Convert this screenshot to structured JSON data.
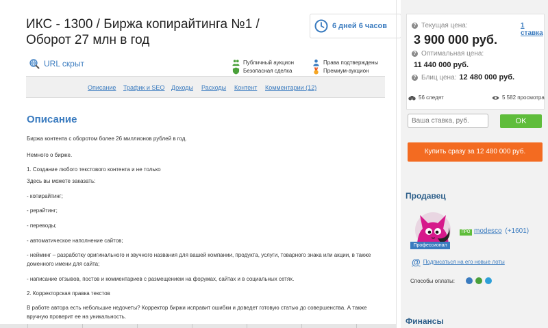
{
  "lot": {
    "title": "ИКС - 1300 / Биржа копирайтинга №1 / Оборот 27 млн в год",
    "timer": "6 дней 6 часов",
    "url_text": "URL скрыт"
  },
  "features": {
    "public_auction": "Публичный аукцион",
    "safe_deal": "Безопасная сделка",
    "rights_confirmed": "Права подтверждены",
    "premium_auction": "Премиум-аукцион"
  },
  "tabs": [
    {
      "label": "Описание"
    },
    {
      "label": "Трафик и SEO"
    },
    {
      "label": "Доходы"
    },
    {
      "label": "Расходы"
    },
    {
      "label": "Контент"
    },
    {
      "label": "Комментарии (12)"
    }
  ],
  "description": {
    "heading": "Описание",
    "paragraphs": [
      "Биржа контента с оборотом более 26 миллионов рублей в год.",
      "Немного о бирже.",
      "1. Создание любого текстового контента и не только",
      "Здесь вы можете заказать:",
      "- копирайтинг;",
      "- рерайтинг;",
      "- переводы;",
      "- автоматическое наполнение сайтов;",
      "- нейминг – разработку оригинального и звучного названия для вашей компании, продукта, услуги, товарного знака или акции, в также доменного имени для сайта;",
      "- написание отзывов, постов и комментариев с размещением на форумах, сайтах и в социальных сетях.",
      "2. Корректорская правка текстов",
      "В работе автора есть небольшие недочеты? Корректор биржи исправит ошибки и доведет готовую статью до совершенства. А также вручную проверит ее на уникальность."
    ]
  },
  "pricing": {
    "current_label": "Текущая цена:",
    "bets_link": "1 ставка",
    "current_price": "3 900 000 руб.",
    "optimal_label": "Оптимальная цена:",
    "optimal_price": "11 440 000 руб.",
    "blitz_label": "Блиц цена:",
    "blitz_price": "12 480 000 руб.",
    "followers": "56 следят",
    "views": "5 582 просмотра",
    "bid_placeholder": "Ваша ставка, руб.",
    "ok_label": "OK",
    "buy_label": "Купить сразу за 12 480 000 руб."
  },
  "seller": {
    "heading": "Продавец",
    "pro_badge": "Профессионал",
    "pro_mark": "ПРО",
    "name": "modesco",
    "rating": "(+1601)",
    "subscribe": "Подписаться на его новые лоты",
    "payment_label": "Способы оплаты:"
  },
  "finance": {
    "heading": "Финансы"
  },
  "colors": {
    "accent": "#3a7bbf",
    "ok_green": "#5fbd3b",
    "buy_orange": "#f36b21",
    "sidebar_bg": "#f2f2f2"
  }
}
